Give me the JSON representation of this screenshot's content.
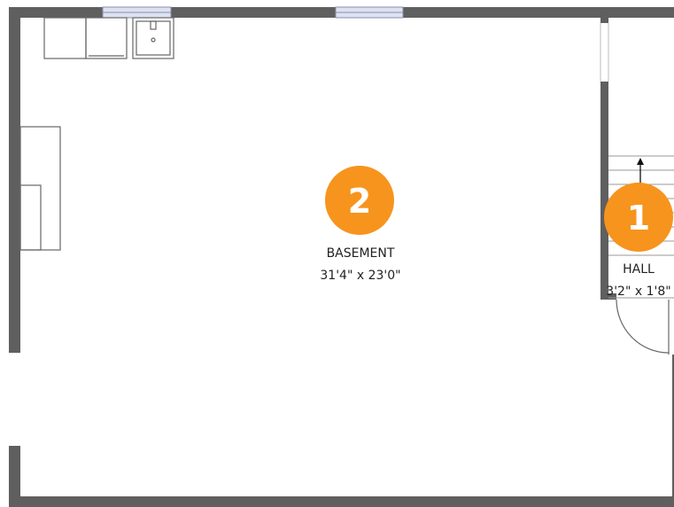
{
  "colors": {
    "wall": "#5f5f5f",
    "badge": "#f7941d",
    "fixture_stroke": "#666666",
    "window_fill": "#dde2f2"
  },
  "rooms": [
    {
      "id": "basement",
      "badge": "2",
      "name": "BASEMENT",
      "dimensions": "31'4\" x 23'0\""
    },
    {
      "id": "hall",
      "badge": "1",
      "name": "HALL",
      "dimensions": "3'2\" x 1'8\""
    }
  ],
  "icons": {
    "stair_arrow": "up-arrow-icon",
    "sink": "sink-icon",
    "door": "door-swing-icon"
  }
}
